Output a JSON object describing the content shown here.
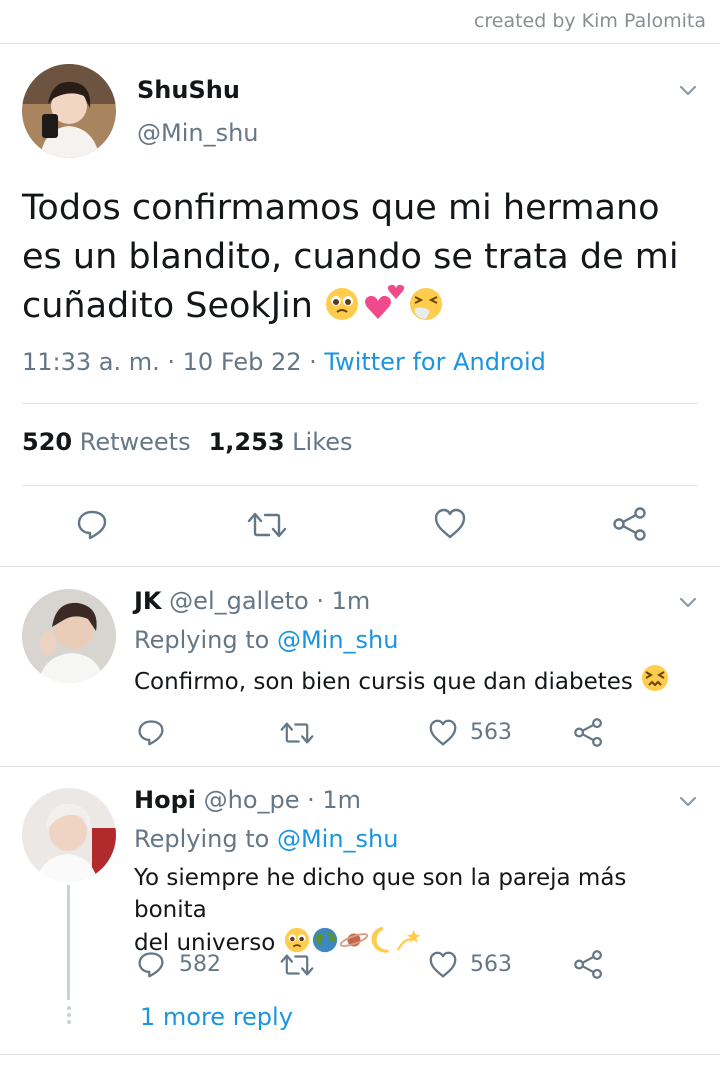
{
  "credit": "created by Kim Palomita",
  "tweet": {
    "name": "ShuShu",
    "handle": "@Min_shu",
    "text": "Todos confirmamos que mi hermano es un blandito, cuando se trata de mi cuñadito SeokJin",
    "emojis": [
      "pleading-face",
      "two-hearts",
      "sneezing-face"
    ],
    "time": "11:33 a. m. · 10 Feb 22 · ",
    "source": "Twitter for Android",
    "retweets_count": "520",
    "retweets_label": "Retweets",
    "likes_count": "1,253",
    "likes_label": "Likes"
  },
  "replies": [
    {
      "name": "JK",
      "handle": "@el_galleto · 1m",
      "replying_prefix": "Replying to ",
      "replying_to": "@Min_shu",
      "text": "Confirmo, son bien cursis que dan diabetes",
      "emojis": [
        "persevering-face"
      ],
      "reply_count": "",
      "likes": "563"
    },
    {
      "name": "Hopi",
      "handle": "@ho_pe · 1m",
      "replying_prefix": "Replying to ",
      "replying_to": "@Min_shu",
      "text_line1": "Yo siempre he dicho que son la pareja más bonita",
      "text_line2": "del universo",
      "emojis": [
        "pleading-face",
        "globe",
        "ringed-planet",
        "crescent-moon",
        "dizzy"
      ],
      "reply_count": "582",
      "likes": "563"
    }
  ],
  "more_replies": "1 more reply",
  "colors": {
    "link": "#1b95e0",
    "secondary": "#657786",
    "divider": "#dfe3e6"
  }
}
